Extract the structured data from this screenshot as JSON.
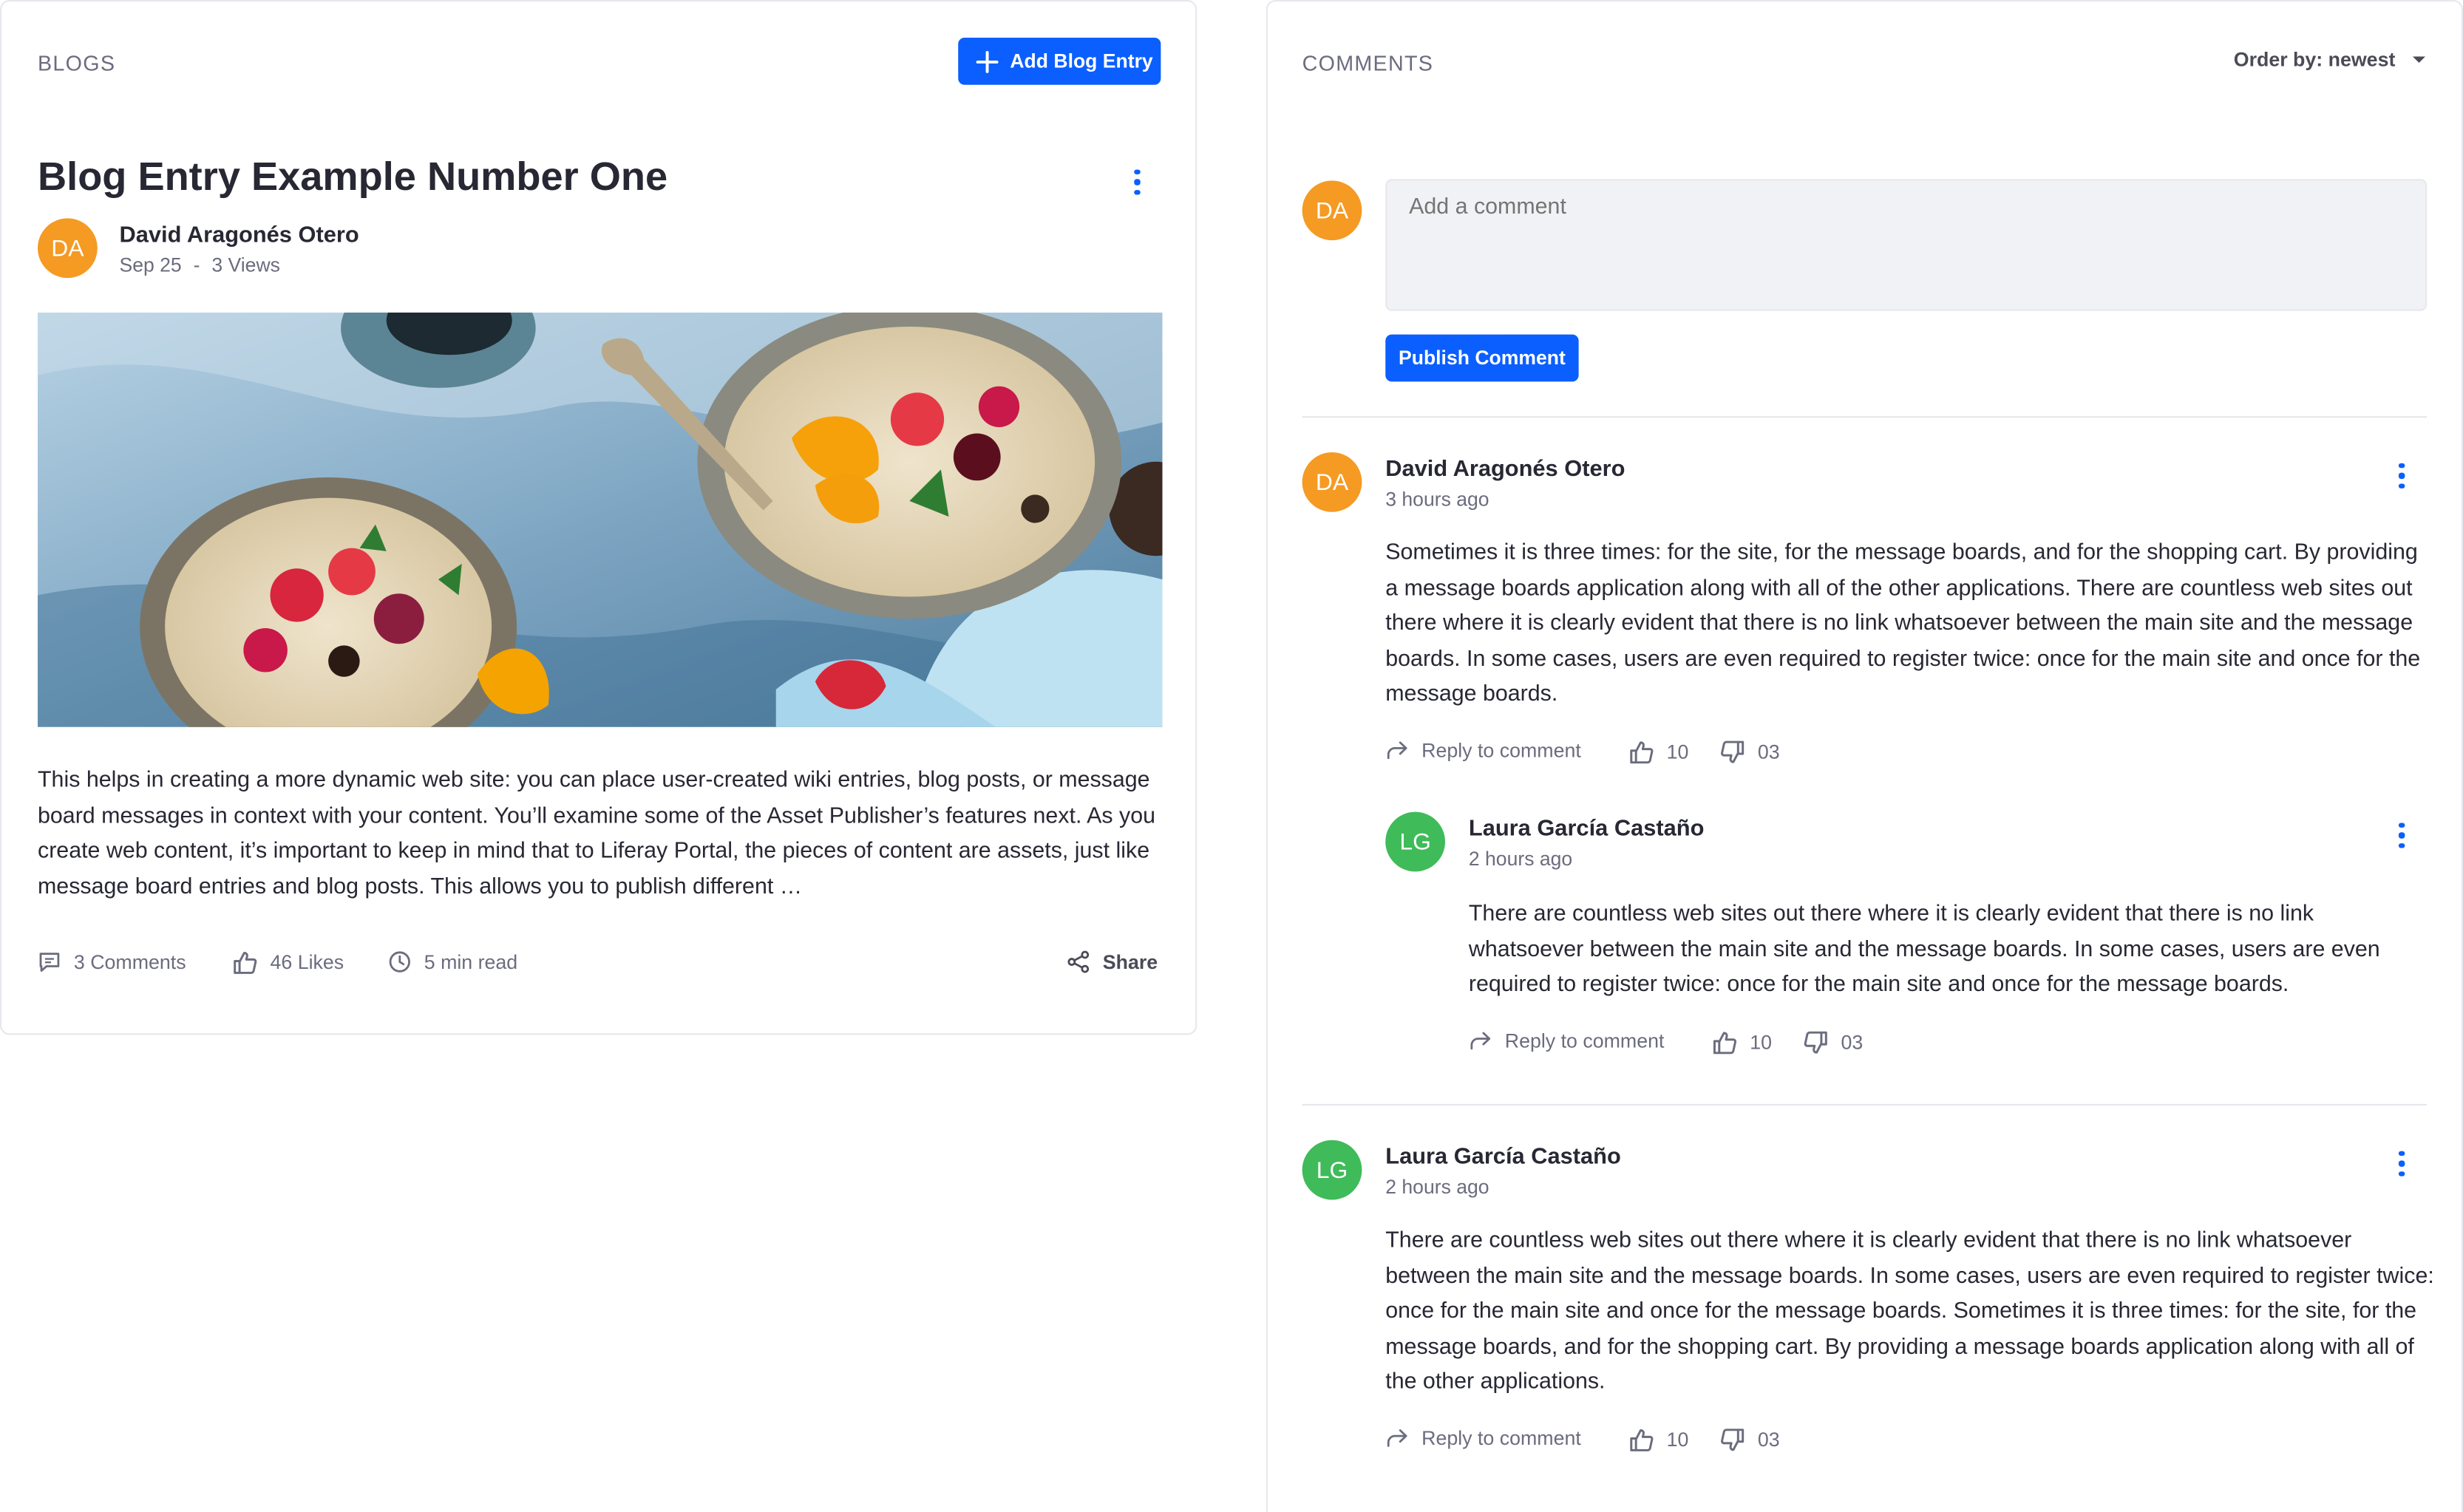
{
  "blogs": {
    "section_title": "BLOGS",
    "add_button_label": "Add Blog Entry",
    "entry": {
      "title": "Blog Entry Example Number One",
      "author_initials": "DA",
      "author_name": "David Aragonés Otero",
      "date": "Sep 25",
      "separator": "-",
      "views": "3 Views",
      "excerpt": "This helps in creating a more dynamic web site: you can place user-created wiki entries, blog posts, or message board messages in context with your content. You’ll examine some of the Asset Publisher’s features next. As you create web content, it’s important to keep in mind that to Liferay Portal, the pieces of content are assets, just like message board entries and blog posts. This allows you to publish different …",
      "comments_count": "3 Comments",
      "likes_count": "46 Likes",
      "read_time": "5 min read",
      "share_label": "Share"
    }
  },
  "comments": {
    "section_title": "COMMENTS",
    "order_label": "Order by: newest",
    "composer": {
      "avatar_initials": "DA",
      "placeholder": "Add a comment",
      "publish_label": "Publish Comment"
    },
    "reply_label": "Reply to comment",
    "items": [
      {
        "initials": "DA",
        "author": "David Aragonés Otero",
        "time": "3 hours ago",
        "text": "Sometimes it is three times: for the site, for the message boards, and for the shopping cart. By providing a message boards application along with all of the other applications. There are countless web sites out there where it is clearly evident that there is no link whatsoever between the main site and the message boards. In some cases, users are even required to register twice: once for the main site and once for the message boards.",
        "likes": "10",
        "dislikes": "03",
        "reply": {
          "initials": "LG",
          "author": "Laura García Castaño",
          "time": "2 hours ago",
          "text": "There are countless web sites out there where it is clearly evident that there is no link whatsoever between the main site and the message boards. In some cases, users are even required to register twice: once for the main site and once for the message boards.",
          "likes": "10",
          "dislikes": "03"
        }
      },
      {
        "initials": "LG",
        "author": "Laura García Castaño",
        "time": "2 hours ago",
        "text": "There are countless web sites out there where it is clearly evident that there is no link whatsoever between the main site and the message boards. In some cases, users are even required to register twice: once for the main site and once for the message boards. Sometimes it is three times: for the site, for the message boards, and for the shopping cart. By providing a message boards application along with all of the other applications.",
        "likes": "10",
        "dislikes": "03"
      }
    ]
  },
  "colors": {
    "primary": "#0b5fff",
    "avatar_orange": "#f59a23",
    "avatar_green": "#3fbb59",
    "muted_text": "#6b6c7e",
    "border": "#e7e7ed"
  },
  "icons": [
    "plus-icon",
    "kebab-icon",
    "comment-icon",
    "thumbs-up-icon",
    "thumbs-down-icon",
    "clock-icon",
    "share-icon",
    "reply-icon",
    "caret-down-icon"
  ]
}
